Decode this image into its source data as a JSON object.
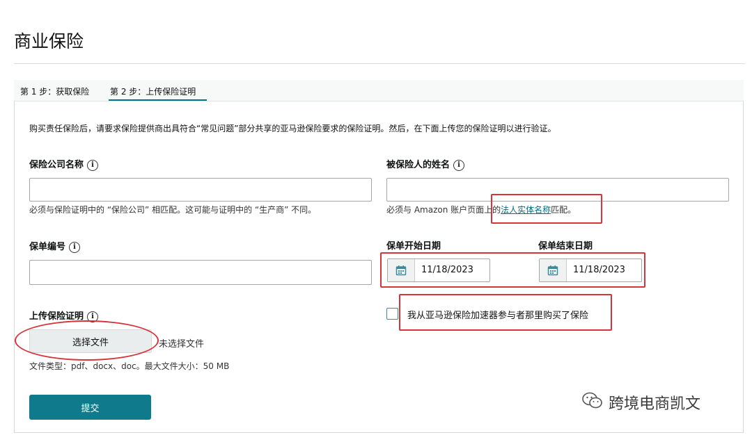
{
  "page": {
    "title": "商业保险"
  },
  "tabs": [
    {
      "label": "第 1 步：获取保险"
    },
    {
      "label": "第 2 步：上传保险证明"
    }
  ],
  "intro": "购买责任保险后，请要求保险提供商出具符合“常见问题”部分共享的亚马逊保险要求的保险证明。然后，在下面上传您的保险证明以进行验证。",
  "fields": {
    "insurer": {
      "label": "保险公司名称",
      "value": "",
      "hint": "必须与保险证明中的 “保险公司” 相匹配。这可能与证明中的 “生产商” 不同。"
    },
    "insured": {
      "label": "被保险人的姓名",
      "value": "",
      "hint_prefix": "必须与 Amazon 账户页面上的",
      "hint_link": "法人实体名称",
      "hint_suffix": "匹配。"
    },
    "policy_number": {
      "label": "保单编号",
      "value": ""
    },
    "start_date": {
      "label": "保单开始日期",
      "value": "11/18/2023"
    },
    "end_date": {
      "label": "保单结束日期",
      "value": "11/18/2023"
    },
    "accelerator": {
      "label": "我从亚马逊保险加速器参与者那里购买了保险",
      "checked": false
    },
    "upload": {
      "label": "上传保险证明",
      "button": "选择文件",
      "status": "未选择文件",
      "types": "文件类型：pdf、docx、doc。最大文件大小：50 MB"
    }
  },
  "submit_label": "提交",
  "watermark": {
    "text": "跨境电商凯文",
    "icon": "wechat-icon"
  },
  "colors": {
    "accent": "#007185",
    "button": "#0f7a8c",
    "annotation": "#d6343b"
  },
  "icons": {
    "info": "info-icon",
    "calendar": "calendar-icon"
  }
}
